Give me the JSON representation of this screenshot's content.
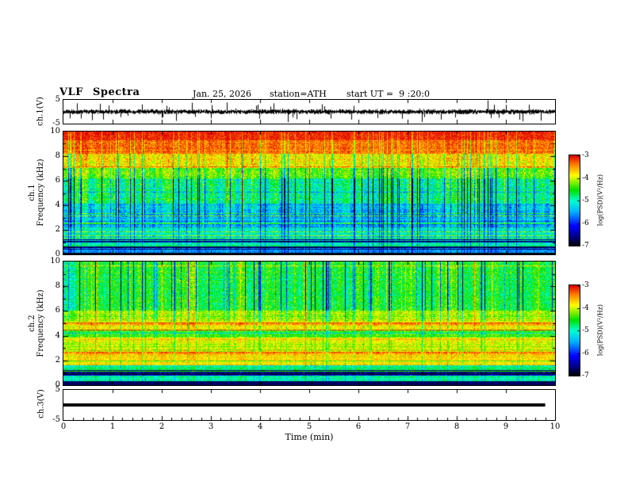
{
  "chart_data": {
    "type": "multi-panel-spectrogram",
    "title": "VLF Spectra",
    "header": {
      "date": "Jan. 25, 2026",
      "station": "station=ATH",
      "start_ut": "start UT =  9 :20:0"
    },
    "xlabel": "Time (min)",
    "xlim": [
      0,
      10
    ],
    "xticks": [
      0,
      1,
      2,
      3,
      4,
      5,
      6,
      7,
      8,
      9,
      10
    ],
    "colormap": [
      {
        "t": 0.0,
        "c": "#000000"
      },
      {
        "t": 0.1,
        "c": "#000080"
      },
      {
        "t": 0.22,
        "c": "#0000ff"
      },
      {
        "t": 0.38,
        "c": "#00b2ff"
      },
      {
        "t": 0.5,
        "c": "#00ffd0"
      },
      {
        "t": 0.62,
        "c": "#00e000"
      },
      {
        "t": 0.78,
        "c": "#ffff00"
      },
      {
        "t": 0.9,
        "c": "#ff8000"
      },
      {
        "t": 1.0,
        "c": "#e00000"
      }
    ],
    "colorbar": {
      "label": "log(PSD)(V²/Hz)",
      "ticks": [
        -3,
        -4,
        -5,
        -6,
        -7
      ],
      "zlim": [
        -7,
        -3
      ]
    },
    "panels": [
      {
        "id": "ch1_voltage",
        "type": "line",
        "ylabel": "ch.1(V)",
        "ylim": [
          -5,
          5
        ],
        "yticks": [
          5,
          -5
        ],
        "seed": 101,
        "signal": {
          "kind": "broadband_noise",
          "rms": 0.9,
          "spike_rate": 0.012,
          "spike_amp": 3.4
        }
      },
      {
        "id": "ch1_spectrogram",
        "type": "heatmap",
        "ylabel_lines": [
          "ch.1",
          "Frequency (kHz)"
        ],
        "ylim": [
          0,
          10
        ],
        "yticks": [
          10,
          8,
          6,
          4,
          2,
          0
        ],
        "zlim": [
          -7,
          -3
        ],
        "seed": 7,
        "streaks": {
          "rate": 0.1,
          "depth": 1.9,
          "bright_rate": 0.05,
          "bright": 0.6
        },
        "bands": [
          {
            "f": [
              9.3,
              10.01
            ],
            "base": -3.1,
            "row_noise": 0.08,
            "pix_noise": 0.3,
            "streak": 0.2,
            "line_prob": 0.0,
            "line_delta": 0.0
          },
          {
            "f": [
              8.2,
              9.3
            ],
            "base": -3.35,
            "row_noise": 0.1,
            "pix_noise": 0.35,
            "streak": 0.35,
            "line_prob": 0.0,
            "line_delta": 0.0
          },
          {
            "f": [
              7.0,
              8.2
            ],
            "base": -3.8,
            "row_noise": 0.12,
            "pix_noise": 0.45,
            "streak": 0.6,
            "line_prob": 0.05,
            "line_delta": 0.4
          },
          {
            "f": [
              6.2,
              7.0
            ],
            "base": -4.3,
            "row_noise": 0.15,
            "pix_noise": 0.5,
            "streak": 0.8,
            "line_prob": 0.05,
            "line_delta": 0.5
          },
          {
            "f": [
              4.2,
              6.2
            ],
            "base": -4.8,
            "row_noise": 0.2,
            "pix_noise": 0.55,
            "streak": 1.2,
            "line_prob": 0.06,
            "line_delta": -0.7
          },
          {
            "f": [
              3.2,
              4.2
            ],
            "base": -5.35,
            "row_noise": 0.25,
            "pix_noise": 0.5,
            "streak": 1.0,
            "line_prob": 0.1,
            "line_delta": 0.8
          },
          {
            "f": [
              2.1,
              3.2
            ],
            "base": -5.5,
            "row_noise": 0.3,
            "pix_noise": 0.45,
            "streak": 0.7,
            "line_prob": 0.18,
            "line_delta": 0.9
          },
          {
            "f": [
              1.2,
              2.1
            ],
            "base": -5.0,
            "row_noise": 0.3,
            "pix_noise": 0.4,
            "streak": 0.5,
            "line_prob": 0.25,
            "line_delta": 0.8
          },
          {
            "f": [
              0.5,
              1.2
            ],
            "base": -4.9,
            "row_noise": 0.35,
            "pix_noise": 0.4,
            "streak": 0.4,
            "line_prob": 0.3,
            "line_delta": -1.5
          },
          {
            "f": [
              0.15,
              0.5
            ],
            "base": -5.6,
            "row_noise": 0.3,
            "pix_noise": 0.4,
            "streak": 0.3,
            "line_prob": 0.4,
            "line_delta": -1.3
          },
          {
            "f": [
              0.0,
              0.15
            ],
            "base": -6.9,
            "row_noise": 0.05,
            "pix_noise": 0.15,
            "streak": 0.0,
            "line_prob": 0.0,
            "line_delta": 0.0
          }
        ]
      },
      {
        "id": "ch2_spectrogram",
        "type": "heatmap",
        "ylabel_lines": [
          "ch.2",
          "Frequency (kHz)"
        ],
        "ylim": [
          0,
          10
        ],
        "yticks": [
          10,
          8,
          6,
          4,
          2,
          0
        ],
        "zlim": [
          -7,
          -3
        ],
        "seed": 13,
        "streaks": {
          "rate": 0.12,
          "depth": 1.7,
          "bright_rate": 0.04,
          "bright": 0.5
        },
        "bands": [
          {
            "f": [
              6.0,
              10.01
            ],
            "base": -4.55,
            "row_noise": 0.15,
            "pix_noise": 0.45,
            "streak": 1.1,
            "line_prob": 0.04,
            "line_delta": 0.6
          },
          {
            "f": [
              5.2,
              6.0
            ],
            "base": -4.15,
            "row_noise": 0.2,
            "pix_noise": 0.4,
            "streak": 0.7,
            "line_prob": 0.15,
            "line_delta": 0.5
          },
          {
            "f": [
              4.4,
              5.2
            ],
            "base": -3.9,
            "row_noise": 0.25,
            "pix_noise": 0.35,
            "streak": 0.4,
            "line_prob": 0.3,
            "line_delta": 0.5
          },
          {
            "f": [
              3.9,
              4.4
            ],
            "base": -4.4,
            "row_noise": 0.2,
            "pix_noise": 0.4,
            "streak": 0.4,
            "line_prob": 0.15,
            "line_delta": -0.5
          },
          {
            "f": [
              2.5,
              3.9
            ],
            "base": -3.95,
            "row_noise": 0.3,
            "pix_noise": 0.35,
            "streak": 0.3,
            "line_prob": 0.35,
            "line_delta": 0.45
          },
          {
            "f": [
              1.6,
              2.5
            ],
            "base": -3.8,
            "row_noise": 0.25,
            "pix_noise": 0.3,
            "streak": 0.25,
            "line_prob": 0.2,
            "line_delta": -0.7
          },
          {
            "f": [
              0.9,
              1.6
            ],
            "base": -4.7,
            "row_noise": 0.3,
            "pix_noise": 0.4,
            "streak": 0.3,
            "line_prob": 0.3,
            "line_delta": -1.8
          },
          {
            "f": [
              0.35,
              0.9
            ],
            "base": -5.0,
            "row_noise": 0.3,
            "pix_noise": 0.4,
            "streak": 0.3,
            "line_prob": 0.4,
            "line_delta": -1.5
          },
          {
            "f": [
              0.0,
              0.35
            ],
            "base": -6.7,
            "row_noise": 0.1,
            "pix_noise": 0.2,
            "streak": 0.0,
            "line_prob": 0.0,
            "line_delta": 0.0
          }
        ]
      },
      {
        "id": "ch3_voltage",
        "type": "line",
        "ylabel": "ch.3(V)",
        "ylim": [
          -5,
          5
        ],
        "yticks": [
          5,
          -5
        ],
        "minor_xticks": true,
        "seed": 5,
        "signal": {
          "kind": "flat",
          "value": 0,
          "half_width_v": 0.3,
          "x_end": 9.8
        }
      }
    ]
  }
}
